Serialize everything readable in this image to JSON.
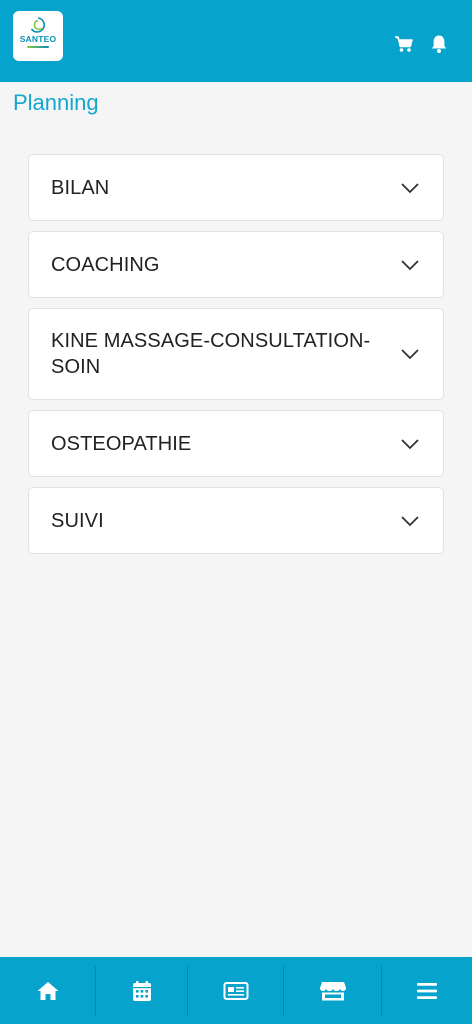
{
  "brand": {
    "logo_text": "SANTEO",
    "accent": "#06a4cc"
  },
  "header": {
    "cart_icon": "cart-icon",
    "bell_icon": "bell-icon"
  },
  "page": {
    "title": "Planning"
  },
  "accordion": {
    "items": [
      {
        "label": "BILAN"
      },
      {
        "label": "COACHING"
      },
      {
        "label": "KINE MASSAGE-CONSULTATION-SOIN"
      },
      {
        "label": "OSTEOPATHIE"
      },
      {
        "label": "SUIVI"
      }
    ]
  },
  "bottom_nav": {
    "items": [
      {
        "icon": "home-icon"
      },
      {
        "icon": "calendar-icon"
      },
      {
        "icon": "newspaper-icon"
      },
      {
        "icon": "store-icon"
      },
      {
        "icon": "menu-icon"
      }
    ]
  }
}
